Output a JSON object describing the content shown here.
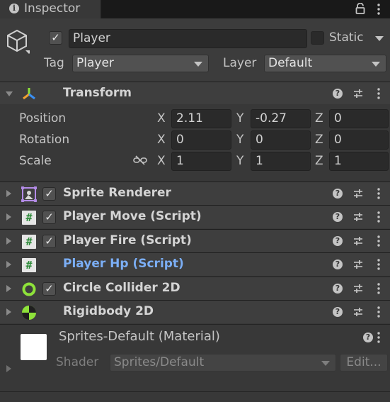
{
  "tab": {
    "title": "Inspector"
  },
  "gameobject": {
    "name": "Player",
    "active": true,
    "static_label": "Static",
    "static": false,
    "tag_label": "Tag",
    "tag_value": "Player",
    "layer_label": "Layer",
    "layer_value": "Default"
  },
  "transform": {
    "title": "Transform",
    "position": {
      "label": "Position",
      "x": "2.11",
      "y": "-0.27",
      "z": "0"
    },
    "rotation": {
      "label": "Rotation",
      "x": "0",
      "y": "0",
      "z": "0"
    },
    "scale": {
      "label": "Scale",
      "x": "1",
      "y": "1",
      "z": "1"
    },
    "axis_x": "X",
    "axis_y": "Y",
    "axis_z": "Z"
  },
  "components": [
    {
      "title": "Sprite Renderer",
      "enabled": true,
      "icon": "sprite-renderer-icon"
    },
    {
      "title": "Player Move (Script)",
      "enabled": true,
      "icon": "script-icon"
    },
    {
      "title": "Player Fire (Script)",
      "enabled": true,
      "icon": "script-icon"
    },
    {
      "title": "Player Hp (Script)",
      "icon": "script-icon",
      "link_color": "#7baef5"
    },
    {
      "title": "Circle Collider 2D",
      "enabled": true,
      "icon": "circle-collider-icon"
    },
    {
      "title": "Rigidbody 2D",
      "icon": "rigidbody-icon"
    }
  ],
  "material": {
    "name": "Sprites-Default (Material)",
    "shader_label": "Shader",
    "shader_value": "Sprites/Default",
    "edit_label": "Edit..."
  },
  "colors": {
    "panel": "#383838",
    "header": "#3e3e3e",
    "field": "#2a2a2a",
    "accent_link": "#7baef5",
    "collider_green": "#8ee23a"
  }
}
